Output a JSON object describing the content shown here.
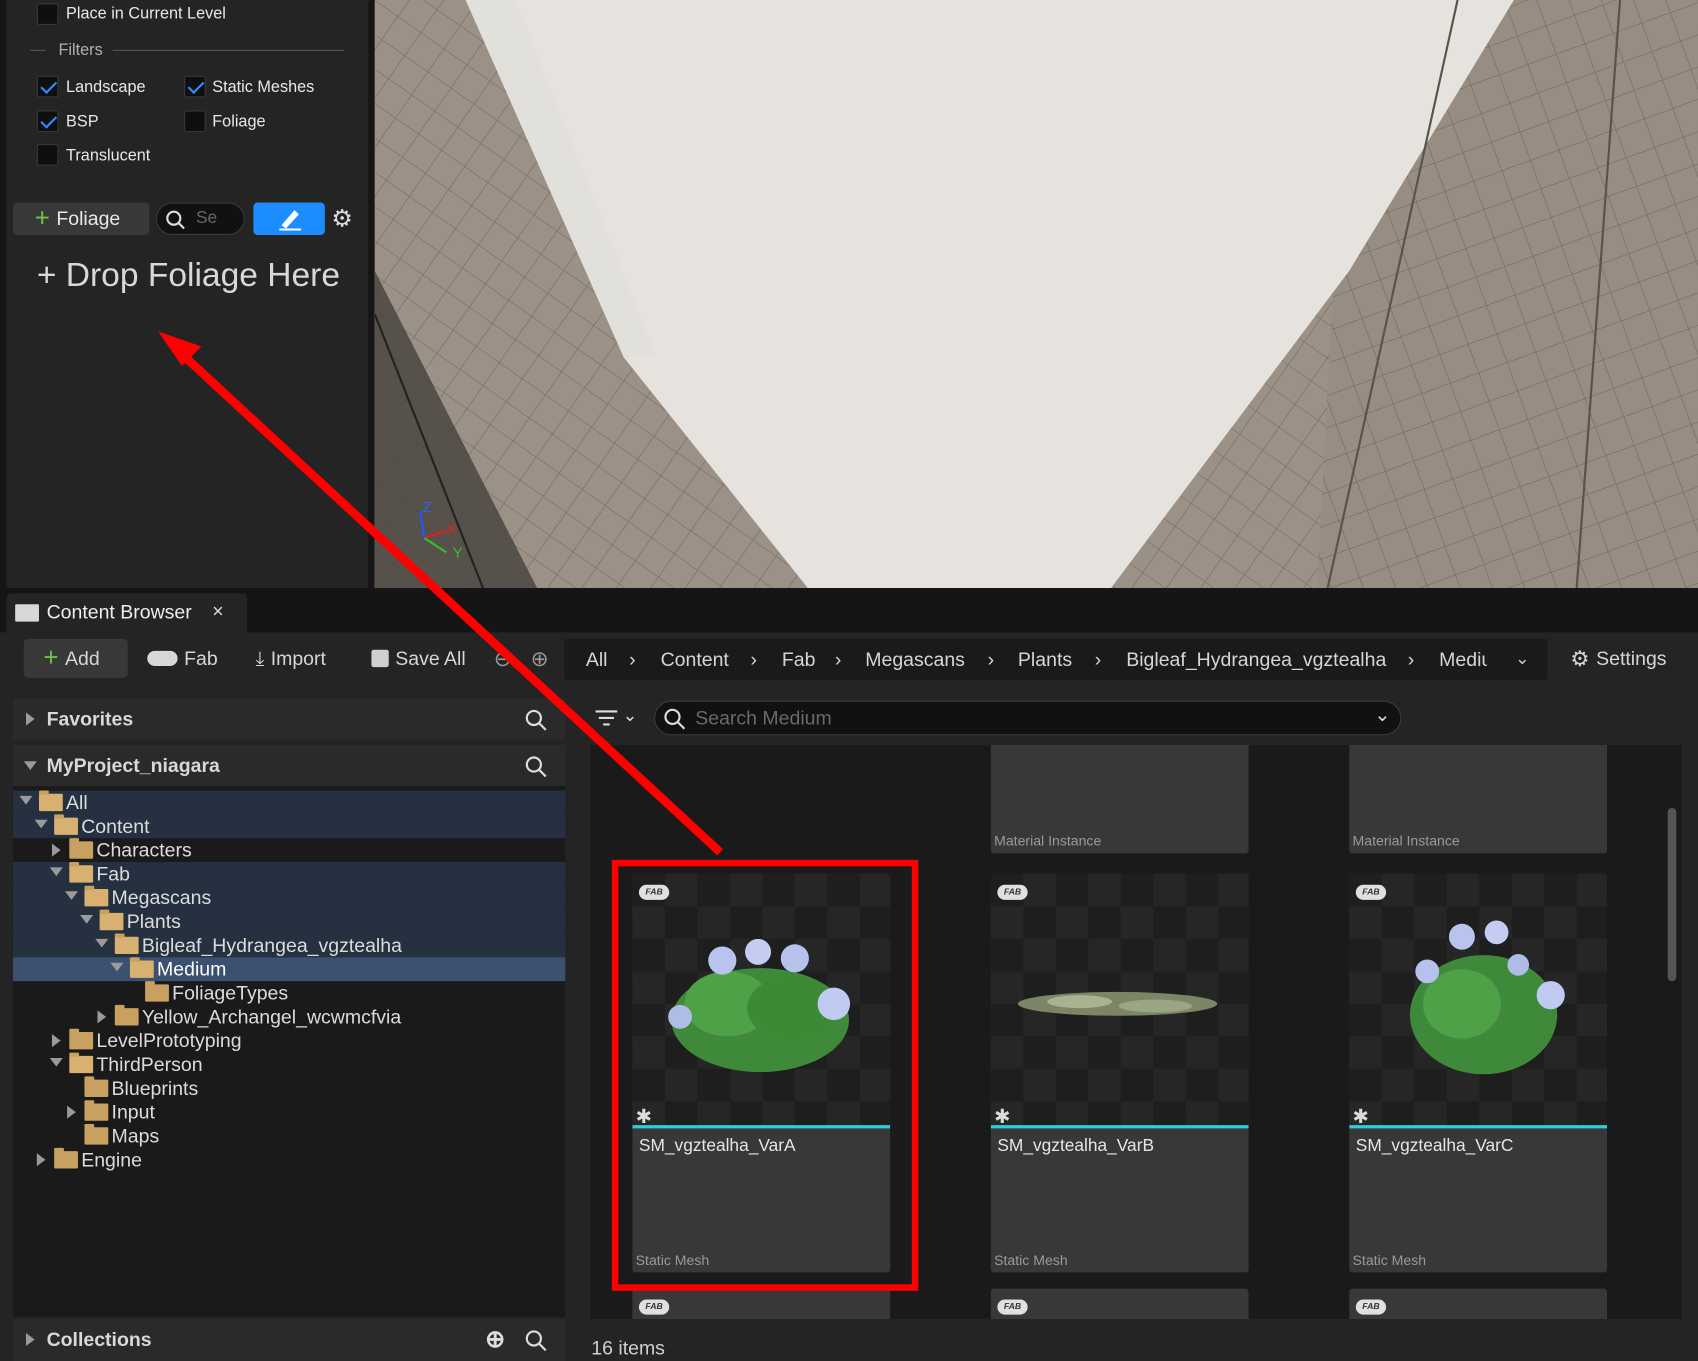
{
  "foliage_panel": {
    "place_in_current_level": {
      "label": "Place in Current Level",
      "checked": false
    },
    "filters_title": "Filters",
    "filters": [
      {
        "label": "Landscape",
        "checked": true
      },
      {
        "label": "Static Meshes",
        "checked": true
      },
      {
        "label": "BSP",
        "checked": true
      },
      {
        "label": "Foliage",
        "checked": false
      },
      {
        "label": "Translucent",
        "checked": false
      }
    ],
    "add_foliage_label": "Foliage",
    "search_placeholder": "Se",
    "drop_text": "+ Drop Foliage Here"
  },
  "viewport": {
    "axis_labels": {
      "z": "Z",
      "x": "X",
      "y": "Y"
    }
  },
  "content_browser": {
    "tab_title": "Content Browser",
    "toolbar": {
      "add_label": "Add",
      "fab_label": "Fab",
      "import_label": "Import",
      "save_all_label": "Save All",
      "settings_label": "Settings"
    },
    "breadcrumbs": [
      "All",
      "Content",
      "Fab",
      "Megascans",
      "Plants",
      "Bigleaf_Hydrangea_vgztealha",
      "Mediu"
    ],
    "favorites_label": "Favorites",
    "project_label": "MyProject_niagara",
    "collections_label": "Collections",
    "search_placeholder": "Search Medium",
    "tree": [
      {
        "label": "All"
      },
      {
        "label": "Content"
      },
      {
        "label": "Characters"
      },
      {
        "label": "Fab"
      },
      {
        "label": "Megascans"
      },
      {
        "label": "Plants"
      },
      {
        "label": "Bigleaf_Hydrangea_vgztealha"
      },
      {
        "label": "Medium"
      },
      {
        "label": "FoliageTypes"
      },
      {
        "label": "Yellow_Archangel_wcwmcfvia"
      },
      {
        "label": "LevelPrototyping"
      },
      {
        "label": "ThirdPerson"
      },
      {
        "label": "Blueprints"
      },
      {
        "label": "Input"
      },
      {
        "label": "Maps"
      },
      {
        "label": "Engine"
      }
    ],
    "top_tiles": [
      {
        "type": "Material Instance"
      },
      {
        "type": "Material Instance"
      }
    ],
    "assets": [
      {
        "name": "SM_vgztealha_VarA",
        "type": "Static Mesh",
        "badge": "FAB"
      },
      {
        "name": "SM_vgztealha_VarB",
        "type": "Static Mesh",
        "badge": "FAB"
      },
      {
        "name": "SM_vgztealha_VarC",
        "type": "Static Mesh",
        "badge": "FAB"
      }
    ],
    "item_count": "16 items"
  },
  "colors": {
    "accent": "#2f8cff",
    "annotation": "#ff0000",
    "asset_bar": "#2bd0e0",
    "selection": "#3c5170"
  }
}
